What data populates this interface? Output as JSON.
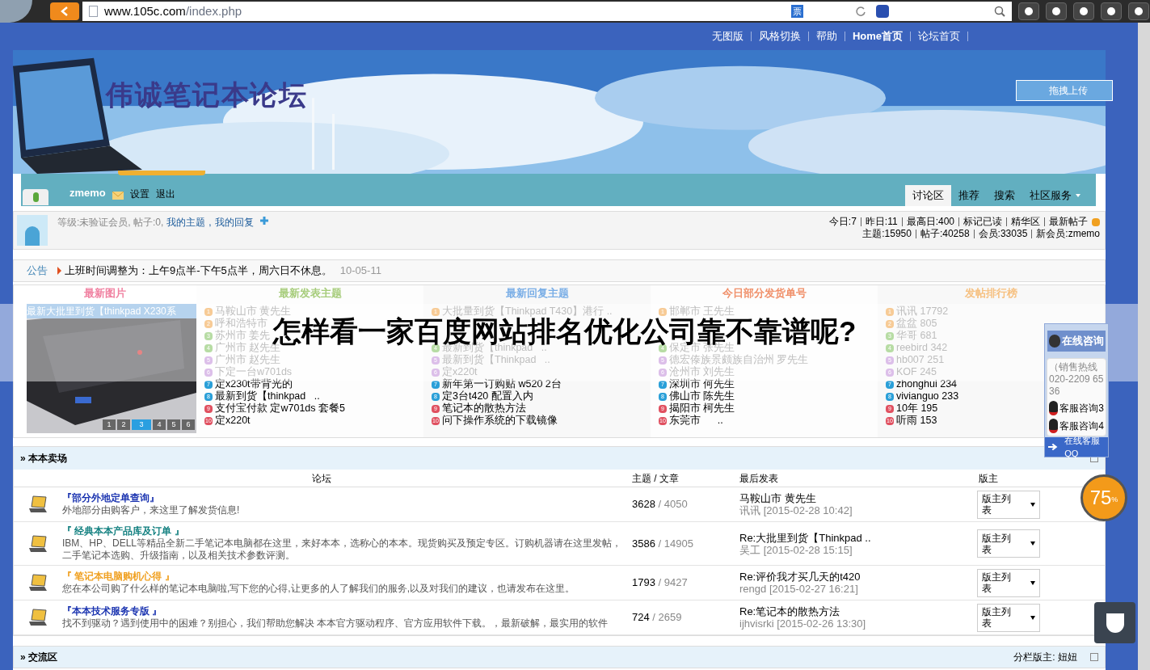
{
  "browser": {
    "url_host": "www.105c.com",
    "url_path": "/index.php",
    "ticket_badge": "票"
  },
  "top_links": [
    "无图版",
    "风格切换",
    "帮助",
    "Home首页",
    "论坛首页"
  ],
  "banner": {
    "logo": "伟诚笔记本论坛",
    "upload_button": "拖拽上传"
  },
  "user_bar": {
    "username": "zmemo",
    "links": [
      "设置",
      "退出"
    ]
  },
  "nav_tabs": [
    {
      "label": "讨论区",
      "selected": true,
      "dropdown": false
    },
    {
      "label": "推荐",
      "selected": false,
      "dropdown": false
    },
    {
      "label": "搜索",
      "selected": false,
      "dropdown": false
    },
    {
      "label": "社区服务",
      "selected": false,
      "dropdown": true
    }
  ],
  "user_info": {
    "text": "等级:未验证会员, 帖子:0,",
    "links": [
      "我的主题",
      "我的回复"
    ],
    "separator": ","
  },
  "stats": [
    [
      "今日:7",
      "昨日:11",
      "最高日:400",
      "标记已读",
      "精华区",
      "最新帖子"
    ],
    [
      "主题:15950",
      "帖子:40258",
      "会员:33035",
      "新会员:zmemo"
    ]
  ],
  "announcement": {
    "label": "公告",
    "text": "上班时间调整为：上午9点半-下午5点半，周六日不休息。",
    "date": "10-05-11"
  },
  "picture_panel": {
    "title": "最新图片",
    "caption": "最新大批里到货【thinkpad X230系",
    "pages": [
      {
        "label": "1",
        "selected": false
      },
      {
        "label": "2",
        "selected": false
      },
      {
        "label": "3",
        "selected": true
      },
      {
        "label": "4",
        "selected": false
      },
      {
        "label": "5",
        "selected": false
      },
      {
        "label": "6",
        "selected": false
      }
    ]
  },
  "panels": [
    {
      "title": "最新发表主题",
      "color": "#a6cc7a",
      "items": [
        {
          "num": "1",
          "text": "马鞍山市 黄先生"
        },
        {
          "num": "2",
          "text": "呼和浩特市"
        },
        {
          "num": "3",
          "text": "苏州市 姜先"
        },
        {
          "num": "4",
          "text": "广州市 赵先生"
        },
        {
          "num": "5",
          "text": "广州市 赵先生"
        },
        {
          "num": "6",
          "text": "下定一台w701ds"
        },
        {
          "num": "7",
          "text": "定x230t带背光的"
        },
        {
          "num": "8",
          "text": "最新到货【thinkpad   .."
        },
        {
          "num": "9",
          "text": "支付宝付款 定w701ds 套餐5"
        },
        {
          "num": "10",
          "text": "定x220t"
        }
      ]
    },
    {
      "title": "最新回复主题",
      "color": "#7aaee6",
      "items": [
        {
          "num": "1",
          "text": "大批量到货【Thinkpad T430】港行 .."
        },
        {
          "kind": "covered"
        },
        {
          "kind": "covered"
        },
        {
          "num": "4",
          "text": "最新到货【thinkpad   .."
        },
        {
          "num": "5",
          "text": "最新到货【Thinkpad   .."
        },
        {
          "num": "6",
          "text": "定x220t"
        },
        {
          "num": "7",
          "text": "新年第一订购贴 w520 2台"
        },
        {
          "num": "8",
          "text": "定3台t420 配置入内"
        },
        {
          "num": "9",
          "text": "笔记本的散热方法"
        },
        {
          "num": "10",
          "text": "问下操作系统的下载镜像"
        }
      ]
    },
    {
      "title": "今日部分发货单号",
      "color": "#f0906a",
      "items": [
        {
          "num": "1",
          "text": "邯郸市 王先生"
        },
        {
          "kind": "covered"
        },
        {
          "kind": "covered"
        },
        {
          "num": "4",
          "text": "保定市 张先生"
        },
        {
          "num": "5",
          "text": "德宏傣族景颇族自治州 罗先生"
        },
        {
          "num": "6",
          "text": "沧州市 刘先生"
        },
        {
          "num": "7",
          "text": "深圳市 何先生"
        },
        {
          "num": "8",
          "text": "佛山市 陈先生"
        },
        {
          "num": "9",
          "text": "揭阳市 柯先生"
        },
        {
          "num": "10",
          "text": "东莞市      .."
        }
      ]
    },
    {
      "title": "发帖排行榜",
      "color": "#f6c080",
      "items": [
        {
          "num": "1",
          "text": "讯讯 17792"
        },
        {
          "num": "2",
          "text": "盆盆 805"
        },
        {
          "num": "3",
          "text": "华哥 681"
        },
        {
          "num": "4",
          "text": "reebird 342"
        },
        {
          "num": "5",
          "text": "hb007 251"
        },
        {
          "num": "6",
          "text": "KOF 245"
        },
        {
          "num": "7",
          "text": "zhonghui 234"
        },
        {
          "num": "8",
          "text": "vivianguo 233"
        },
        {
          "num": "9",
          "text": "10年 195"
        },
        {
          "num": "10",
          "text": "听雨 153"
        }
      ]
    }
  ],
  "forum_section": {
    "title": "» 本本卖场",
    "count_separator": "/",
    "columns": [
      "论坛",
      "主题 / 文章",
      "最后发表",
      "版主"
    ],
    "rows": [
      {
        "name": "『部分外地定单查询』",
        "color": "#1a33b0",
        "desc": "外地部分由购客户，来这里了解发货信息!",
        "topics": "3628",
        "posts": "4050",
        "last_title": "马鞍山市 黄先生",
        "last_by": "讯讯",
        "last_time": "[2015-02-28 10:42]",
        "moderator": "版主列表"
      },
      {
        "name": "『 经典本本产品库及订单 』",
        "color": "#138080",
        "desc": "IBM、HP、DELL等精品全新二手笔记本电脑都在这里，来好本本，选称心的本本。现货购买及预定专区。订购机器请在这里发帖，二手笔记本选购、升级指南，以及相关技术参数评测。",
        "topics": "3586",
        "posts": "14905",
        "last_title": "Re:大批里到货【Thinkpad ..",
        "last_by": "吴工",
        "last_time": "[2015-02-28 15:15]",
        "moderator": "版主列表"
      },
      {
        "name": "『 笔记本电脑购机心得 』",
        "color": "#f0a020",
        "desc": "您在本公司购了什么样的笔记本电脑啦,写下您的心得,让更多的人了解我们的服务,以及对我们的建议，也请发布在这里。",
        "topics": "1793",
        "posts": "9427",
        "last_title": "Re:评价我才买几天的t420",
        "last_by": "rengd",
        "last_time": "[2015-02-27 16:21]",
        "moderator": "版主列表"
      },
      {
        "name": "『本本技术服务专版 』",
        "color": "#1a33b0",
        "desc": "找不到驱动？遇到使用中的困难？别担心，我们帮助您解决 本本官方驱动程序、官方应用软件下载。，最新破解，最实用的软件",
        "topics": "724",
        "posts": "2659",
        "last_title": "Re:笔记本的散热方法",
        "last_by": "ijhvisrki",
        "last_time": "[2015-02-26 13:30]",
        "moderator": "版主列表"
      }
    ]
  },
  "next_section": {
    "title": "» 交流区",
    "moderators": "分栏版主: 妞妞"
  },
  "consult_widget": {
    "title": "在线咨询",
    "hotline": "（销售热线 020-2209 6536",
    "contacts": [
      "客服咨询3",
      "客服咨询4"
    ],
    "footer": "在线客服QQ"
  },
  "progress_badge": {
    "value": "75",
    "unit": "%"
  },
  "overlay_title": "怎样看一家百度网站排名优化公司靠不靠谱呢?"
}
